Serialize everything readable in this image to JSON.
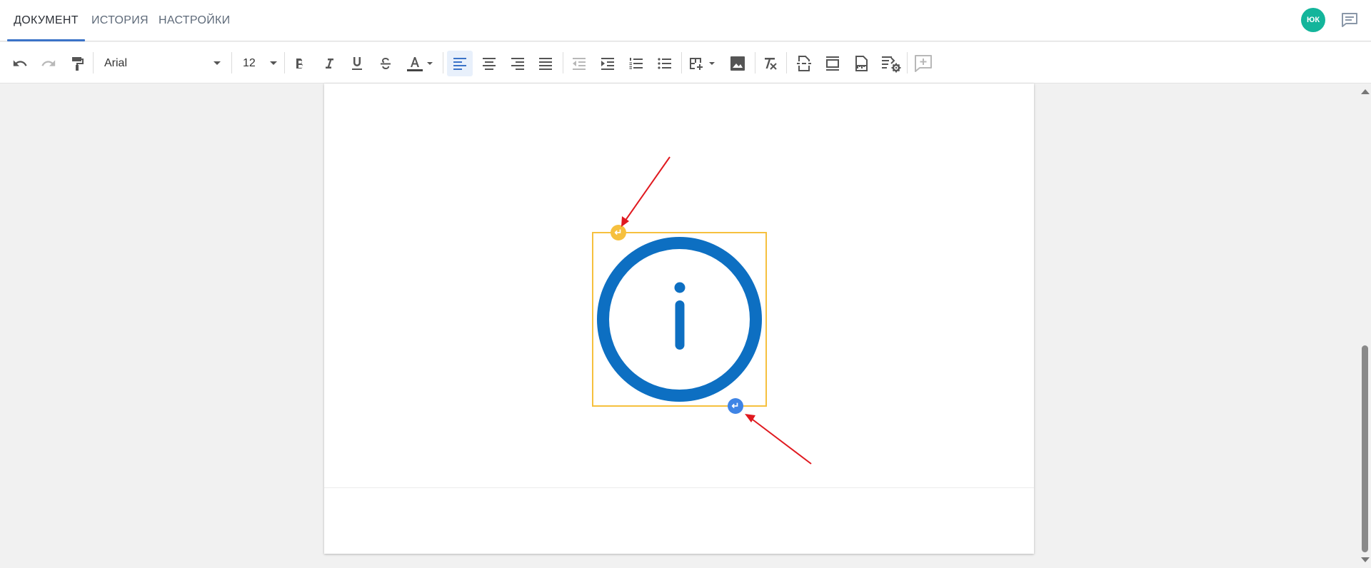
{
  "tabs": [
    {
      "label": "ДОКУМЕНТ",
      "active": true
    },
    {
      "label": "ИСТОРИЯ",
      "active": false
    },
    {
      "label": "НАСТРОЙКИ",
      "active": false
    }
  ],
  "user": {
    "initials": "ЮК",
    "avatar_color": "#13b59b"
  },
  "toolbar": {
    "font_family": "Arial",
    "font_size": "12",
    "alignment": "left",
    "icons": [
      "undo-icon",
      "redo-icon",
      "format-painter-icon",
      "bold-icon",
      "italic-icon",
      "underline-icon",
      "strikethrough-icon",
      "text-color-icon",
      "align-left-icon",
      "align-center-icon",
      "align-right-icon",
      "align-justify-icon",
      "outdent-icon",
      "indent-icon",
      "numbered-list-icon",
      "bulleted-list-icon",
      "table-icon",
      "image-icon",
      "clear-format-icon",
      "page-break-icon",
      "header-footer-icon",
      "page-margins-icon",
      "page-settings-icon",
      "add-comment-icon"
    ]
  },
  "document": {
    "selected_image": "info-icon",
    "image_color": "#0d6fc2",
    "frame_color": "#f6c03e",
    "start_handle_symbol": "↵",
    "end_handle_symbol": "↵",
    "annotation_color": "#e0191f"
  }
}
